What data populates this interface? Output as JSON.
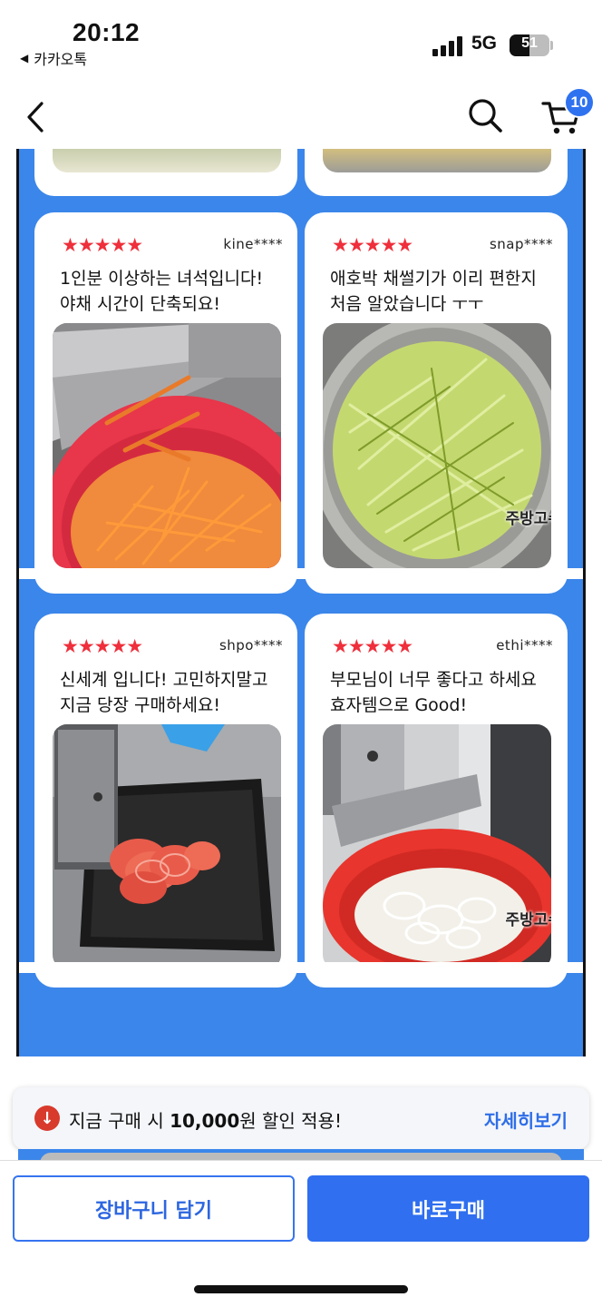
{
  "status_bar": {
    "time": "20:12",
    "back_app": "카카오톡",
    "network": "5G",
    "battery": "51",
    "battery_level": 0.51
  },
  "nav": {
    "cart_count": "10"
  },
  "reviews": [
    {
      "rating_stars": "★★★★★",
      "user": "kine****",
      "line1": "1인분 이상하는 녀석입니다!",
      "line2": "야채 시간이 단축되요!",
      "photo_desc": "carrot-julienne-photo",
      "watermark": ""
    },
    {
      "rating_stars": "★★★★★",
      "user": "snap****",
      "line1": "애호박 채썰기가 이리 편한지",
      "line2": "처음 알았습니다 ㅜㅜ",
      "photo_desc": "zucchini-julienne-photo",
      "watermark": "주방고수"
    },
    {
      "rating_stars": "★★★★★",
      "user": "shpo****",
      "line1": "신세계 입니다! 고민하지말고",
      "line2": "지금 당장 구매하세요!",
      "photo_desc": "tomato-slices-photo",
      "watermark": ""
    },
    {
      "rating_stars": "★★★★★",
      "user": "ethi****",
      "line1": "부모님이 너무 좋다고 하세요",
      "line2": "효자템으로 Good!",
      "photo_desc": "onion-rings-photo",
      "watermark": "주방고수"
    }
  ],
  "promo": {
    "prefix": "지금 구매 시 ",
    "amount": "10,000",
    "suffix": "원 할인 적용!",
    "more_label": "자세히보기"
  },
  "footer": {
    "cart_button": "장바구니 담기",
    "buy_button": "바로구매"
  },
  "colors": {
    "accent": "#2f6ff0",
    "review_bg": "#3b86ea",
    "star": "#ef2f3b"
  }
}
